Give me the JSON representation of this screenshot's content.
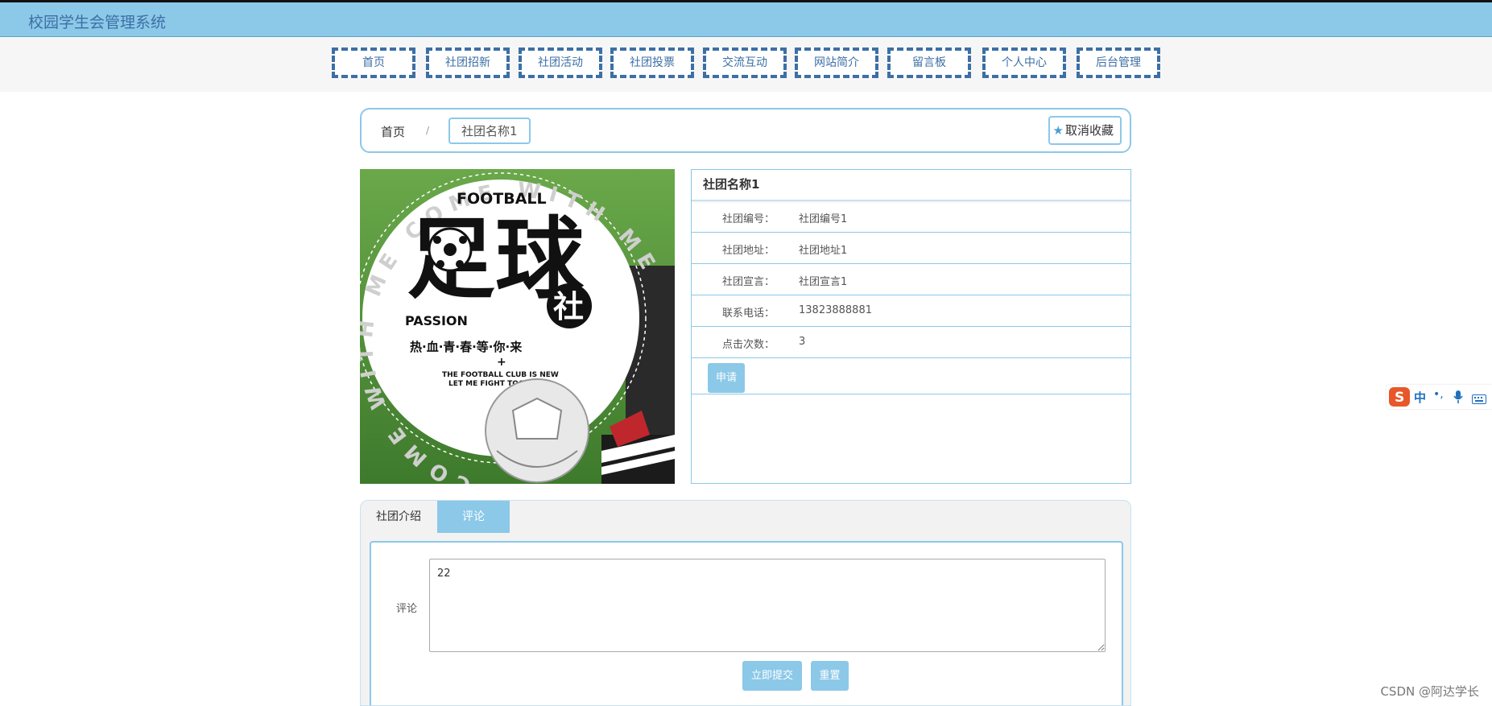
{
  "app": {
    "title": "校园学生会管理系统"
  },
  "nav": {
    "items": [
      {
        "label": "首页"
      },
      {
        "label": "社团招新"
      },
      {
        "label": "社团活动"
      },
      {
        "label": "社团投票"
      },
      {
        "label": "交流互动"
      },
      {
        "label": "网站简介"
      },
      {
        "label": "留言板"
      },
      {
        "label": "个人中心"
      },
      {
        "label": "后台管理"
      }
    ]
  },
  "breadcrumb": {
    "home": "首页",
    "separator": "/",
    "current": "社团名称1"
  },
  "favorite": {
    "label": "取消收藏",
    "icon": "star-icon"
  },
  "poster": {
    "title_en": "FOOTBALL",
    "title_cn_main": "足球",
    "title_cn_badge": "社",
    "passion": "PASSION",
    "slogan": "热·血·青·春·等·你·来",
    "plus": "+",
    "tagline_1": "THE FOOTBALL CLUB IS NEW",
    "tagline_2": "LET ME FIGHT TOGETHER",
    "ring_text": "COME WITH ME COME WITH ME"
  },
  "club": {
    "name": "社团名称1",
    "fields": [
      {
        "label": "社团编号：",
        "value": "社团编号1"
      },
      {
        "label": "社团地址：",
        "value": "社团地址1"
      },
      {
        "label": "社团宣言：",
        "value": "社团宣言1"
      },
      {
        "label": "联系电话：",
        "value": "13823888881"
      },
      {
        "label": "点击次数：",
        "value": "3"
      }
    ],
    "apply_label": "申请"
  },
  "tabs": {
    "intro": "社团介绍",
    "comment": "评论",
    "active": "评论"
  },
  "comment": {
    "label": "评论",
    "value": "22",
    "submit_label": "立即提交",
    "reset_label": "重置"
  },
  "ime": {
    "zh": "中",
    "punct": "•,",
    "icons": [
      "sogou-logo-icon",
      "microphone-icon",
      "keyboard-icon"
    ]
  },
  "watermark": "CSDN @阿达学长",
  "colors": {
    "accent": "#8cc8e8",
    "nav_text": "#3d6fa5"
  }
}
